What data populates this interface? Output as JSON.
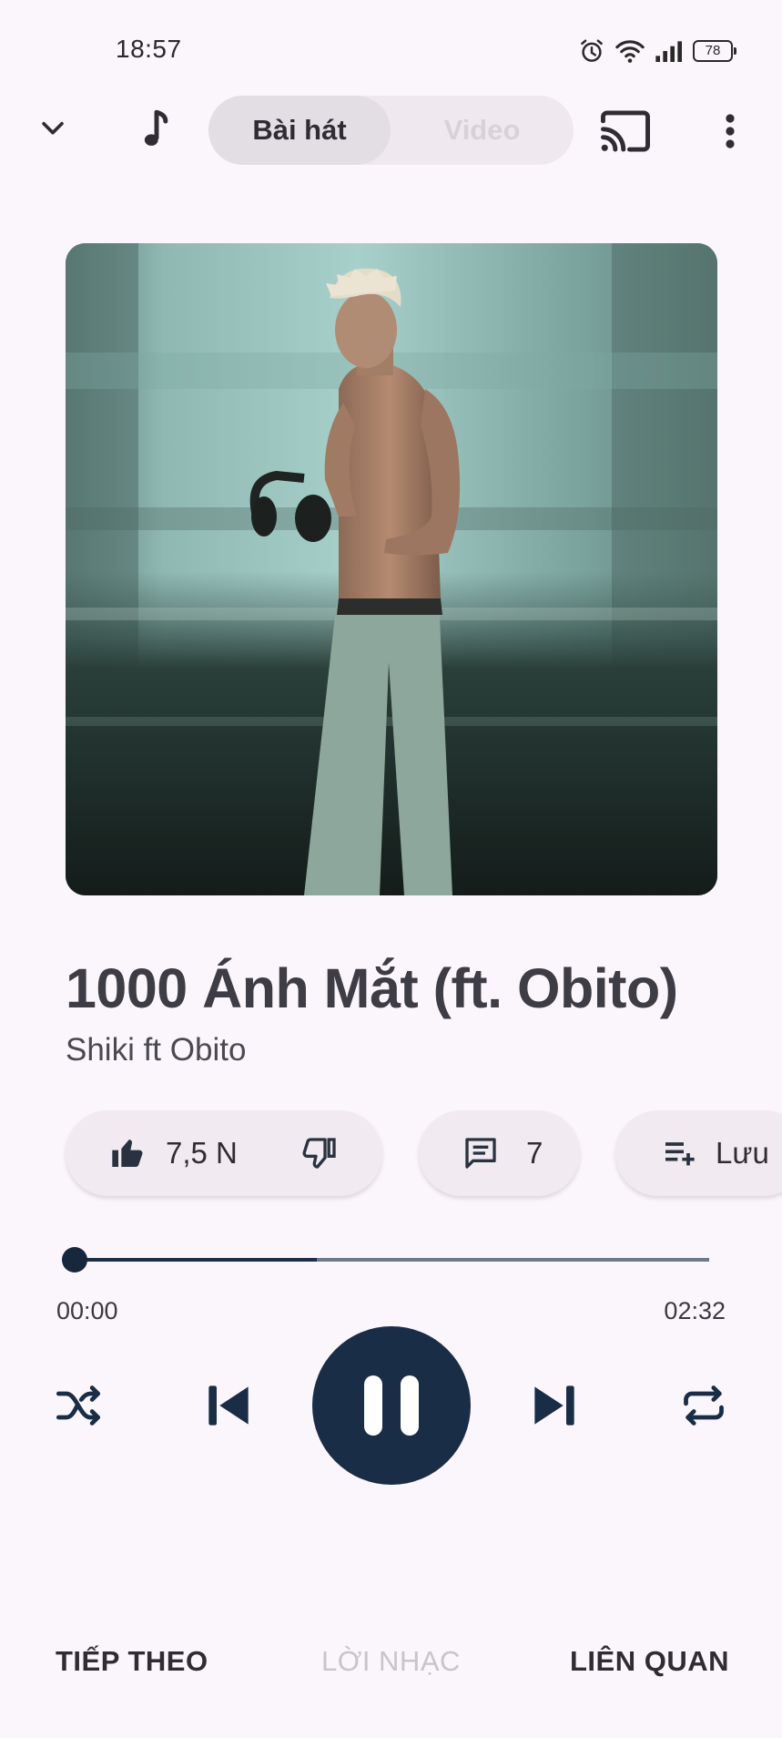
{
  "status_bar": {
    "time": "18:57",
    "battery": "78",
    "icons": [
      "alarm-icon",
      "wifi-icon",
      "signal-icon",
      "battery-icon"
    ]
  },
  "top_bar": {
    "collapse_icon": "chevron-down-icon",
    "note_icon": "music-note-icon",
    "tabs": [
      {
        "label": "Bài hát",
        "selected": true
      },
      {
        "label": "Video",
        "selected": false
      }
    ],
    "cast_icon": "cast-icon",
    "menu_icon": "more-vert-icon"
  },
  "song": {
    "title": "1000 Ánh Mắt (ft. Obito)",
    "artist": "Shiki ft Obito"
  },
  "actions": {
    "like_count": "7,5 N",
    "comment_count": "7",
    "save_label": "Lưu"
  },
  "player": {
    "current_time": "00:00",
    "total_time": "02:32",
    "progress_fraction": 0.0,
    "buffered_fraction": 0.38
  },
  "bottom_tabs": [
    {
      "label": "TIẾP THEO",
      "active": true
    },
    {
      "label": "LỜI NHẠC",
      "active": false
    },
    {
      "label": "LIÊN QUAN",
      "active": true
    }
  ],
  "colors": {
    "background": "#fbf6fb",
    "accent": "#1a2d47",
    "chip": "#f1ebf1",
    "text": "#3e3c44"
  }
}
